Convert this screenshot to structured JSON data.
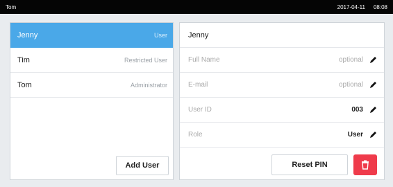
{
  "header": {
    "title": "Tom",
    "date": "2017-04-11",
    "time": "08:08"
  },
  "users": [
    {
      "name": "Jenny",
      "role": "User"
    },
    {
      "name": "Tim",
      "role": "Restricted User"
    },
    {
      "name": "Tom",
      "role": "Administrator"
    }
  ],
  "add_user_label": "Add User",
  "detail": {
    "name": "Jenny",
    "fields": [
      {
        "label": "Full Name",
        "value": "optional"
      },
      {
        "label": "E-mail",
        "value": "optional"
      },
      {
        "label": "User ID",
        "value": "003"
      },
      {
        "label": "Role",
        "value": "User"
      }
    ],
    "reset_pin_label": "Reset PIN"
  },
  "colors": {
    "selected": "#4aa8e8",
    "delete": "#ef3b4b"
  },
  "icons": {
    "edit": "pencil-icon",
    "delete": "trash-icon"
  }
}
